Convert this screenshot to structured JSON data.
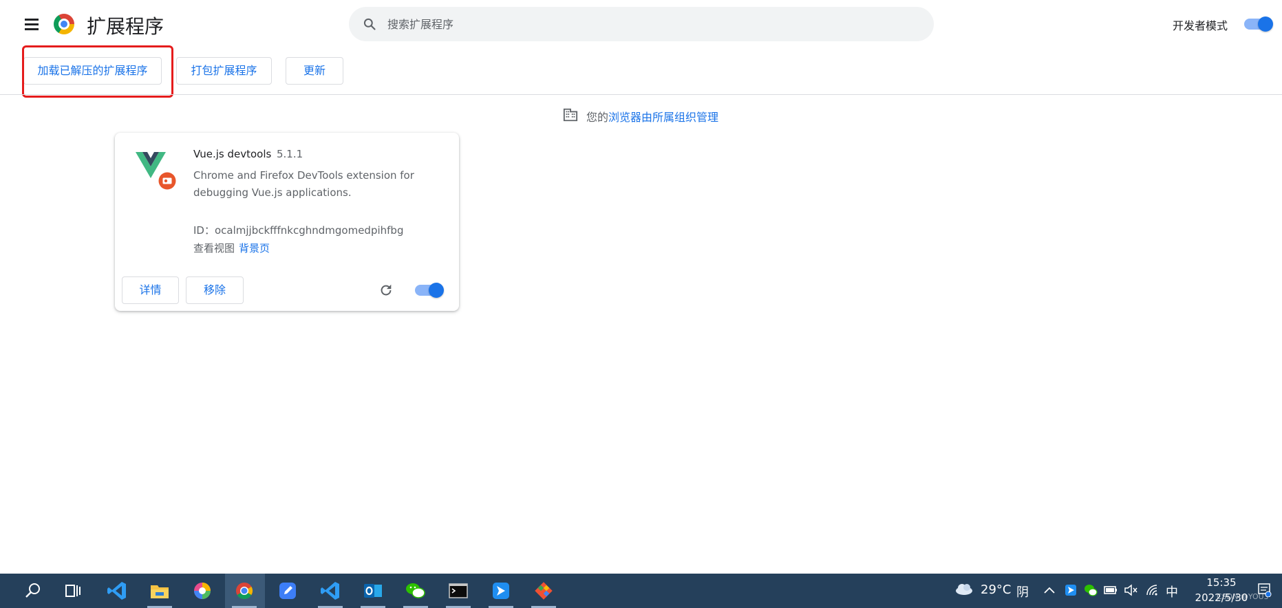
{
  "header": {
    "title": "扩展程序",
    "search_placeholder": "搜索扩展程序",
    "dev_mode_label": "开发者模式",
    "dev_mode_on": true
  },
  "actions": {
    "load_unpacked": "加载已解压的扩展程序",
    "pack": "打包扩展程序",
    "update": "更新"
  },
  "managed": {
    "prefix": "您的",
    "link": "浏览器由所属组织管理"
  },
  "extension": {
    "name": "Vue.js devtools",
    "version": "5.1.1",
    "description": "Chrome and Firefox DevTools extension for debugging Vue.js applications.",
    "id_text": "ID：ocalmjjbckfffnkcghndmgomedpihfbg",
    "views_label": "查看视图",
    "views_link": "背景页",
    "details_label": "详情",
    "remove_label": "移除",
    "enabled": true
  },
  "taskbar": {
    "apps": [
      "search-icon",
      "task-view-icon",
      "vscode-icon",
      "file-explorer-icon",
      "color-app-icon",
      "chrome-icon",
      "notes-app-icon",
      "vscode-icon",
      "outlook-icon",
      "wechat-icon",
      "terminal-icon",
      "feishu-icon",
      "git-icon"
    ],
    "weather_temp": "29°C",
    "weather_desc": "阴",
    "input_method": "中",
    "time": "15:35",
    "date": "2022/5/30",
    "watermark": "CSDN @YOU3"
  },
  "colors": {
    "accent": "#1a73e8",
    "highlight": "#e51c1c",
    "taskbar": "#25405b"
  }
}
